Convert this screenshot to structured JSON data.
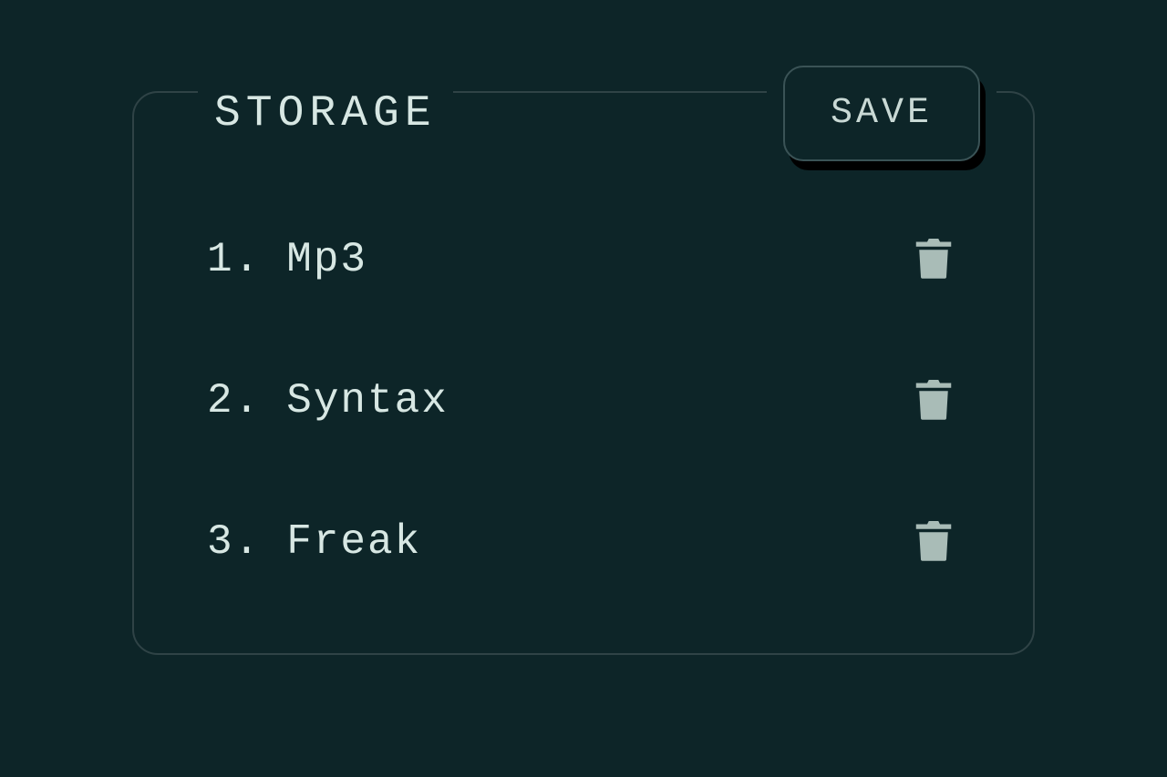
{
  "panel": {
    "title": "STORAGE",
    "save_label": "SAVE"
  },
  "items": [
    {
      "index": "1.",
      "name": "Mp3"
    },
    {
      "index": "2.",
      "name": "Syntax"
    },
    {
      "index": "3.",
      "name": "Freak"
    }
  ]
}
